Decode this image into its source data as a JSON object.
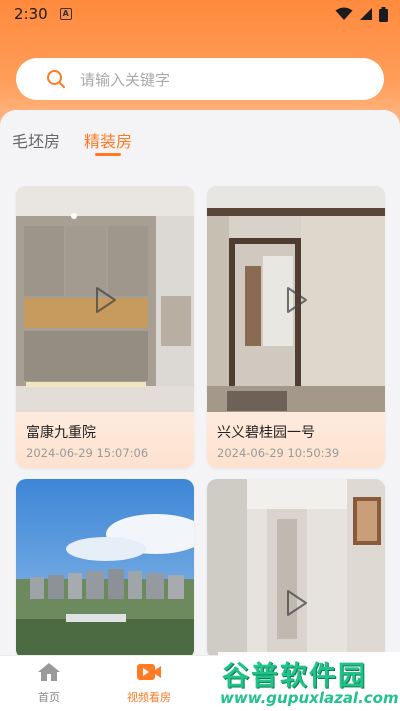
{
  "status_bar": {
    "time": "2:30",
    "notification_icon": "a-app-icon",
    "icons": [
      "wifi-icon",
      "signal-icon",
      "battery-icon"
    ]
  },
  "search": {
    "placeholder": "请输入关键字",
    "icon": "search-icon"
  },
  "tabs": [
    {
      "label": "毛坯房",
      "active": false
    },
    {
      "label": "精装房",
      "active": true
    }
  ],
  "videos": [
    {
      "title": "富康九重院",
      "time": "2024-06-29 15:07:06"
    },
    {
      "title": "兴义碧桂园一号",
      "time": "2024-06-29 10:50:39"
    },
    {
      "title": "",
      "time": ""
    },
    {
      "title": "",
      "time": ""
    }
  ],
  "bottom_nav": [
    {
      "label": "首页",
      "icon": "home-icon",
      "active": false
    },
    {
      "label": "视频看房",
      "icon": "video-camera-icon",
      "active": true
    }
  ],
  "watermark": {
    "logo": "谷普软件园",
    "url": "www.gupuxlazal.com"
  },
  "colors": {
    "accent": "#ff7a22",
    "header_top": "#ff8a3d",
    "watermark": "#22c38a"
  }
}
